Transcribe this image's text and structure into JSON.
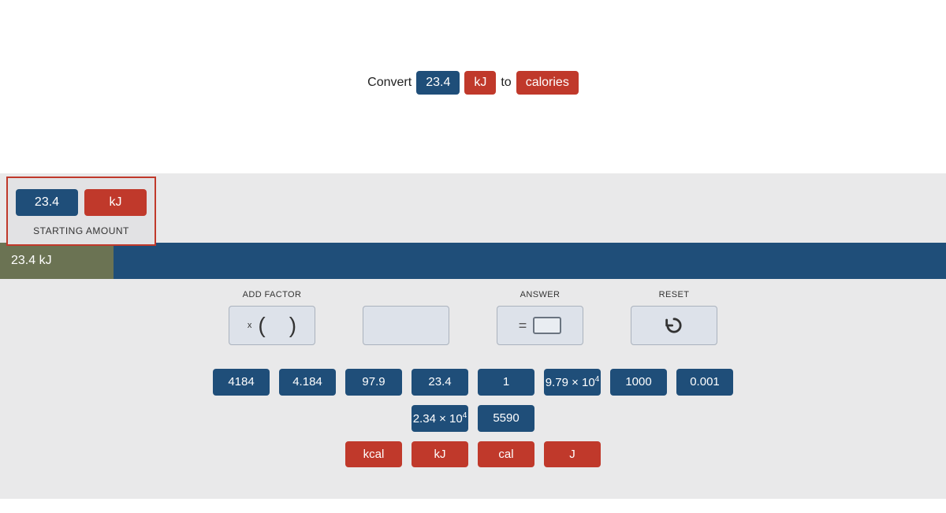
{
  "prompt": {
    "pre": "Convert",
    "value": "23.4",
    "unit_from": "kJ",
    "mid": "to",
    "unit_to": "calories"
  },
  "starting": {
    "value": "23.4",
    "unit": "kJ",
    "label": "STARTING AMOUNT"
  },
  "result_bar": {
    "segment": "23.4 kJ"
  },
  "controls": {
    "add_factor_label": "ADD FACTOR",
    "answer_label": "ANSWER",
    "reset_label": "RESET",
    "multiply_sym": "x",
    "paren_open": "(",
    "paren_close": ")",
    "equals": "="
  },
  "value_tiles_row1": [
    "4184",
    "4.184",
    "97.9",
    "23.4",
    "1",
    "9.79 × 10⁴",
    "1000",
    "0.001"
  ],
  "value_tiles_row2": [
    "2.34 × 10⁴",
    "5590"
  ],
  "unit_tiles": [
    "kcal",
    "kJ",
    "cal",
    "J"
  ],
  "colors": {
    "blue": "#1f4e79",
    "red": "#c0392b",
    "olive": "#6b7353"
  }
}
